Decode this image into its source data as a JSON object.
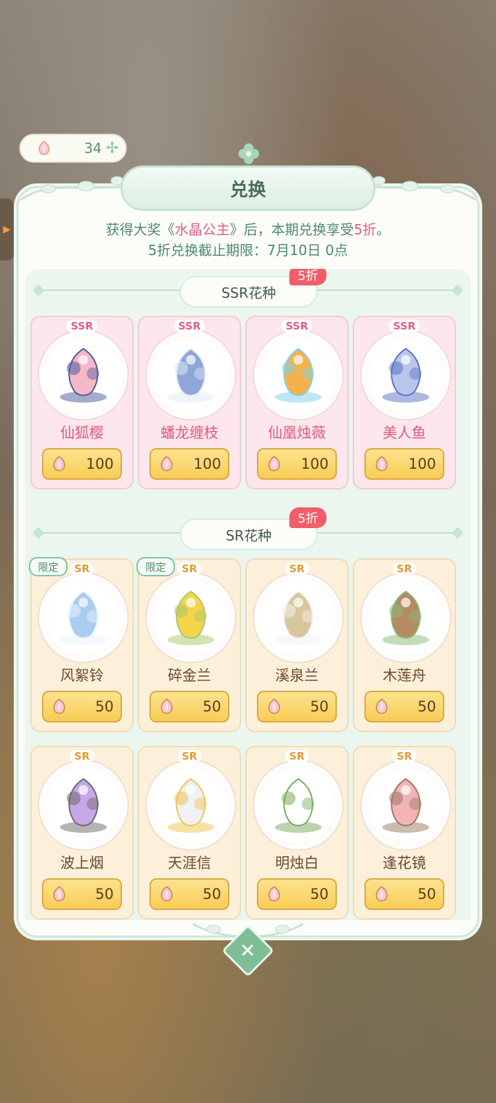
{
  "currency": {
    "amount": "34",
    "icon": "flower-seed-icon",
    "add_icon": "plus-icon"
  },
  "title": "兑换",
  "intro": {
    "line1_prefix": "获得大奖《",
    "line1_prize": "水晶公主",
    "line1_mid": "》后，本期兑换享受",
    "line1_discount": "5折",
    "line1_suffix": "。",
    "line2": "5折兑换截止期限：7月10日 0点"
  },
  "sections": [
    {
      "title": "SSR花种",
      "discount_tag": "5折",
      "items": [
        {
          "rarity": "SSR",
          "name": "仙狐樱",
          "price": "100",
          "art": "fox-shrine-icon",
          "limited": ""
        },
        {
          "rarity": "SSR",
          "name": "蟠龙缠枝",
          "price": "100",
          "art": "dragon-icon",
          "limited": ""
        },
        {
          "rarity": "SSR",
          "name": "仙凰烛薇",
          "price": "100",
          "art": "phoenix-icon",
          "limited": ""
        },
        {
          "rarity": "SSR",
          "name": "美人鱼",
          "price": "100",
          "art": "mermaid-icon",
          "limited": ""
        }
      ]
    },
    {
      "title": "SR花种",
      "discount_tag": "5折",
      "items": [
        {
          "rarity": "SR",
          "name": "风絮铃",
          "price": "50",
          "art": "bluebell-icon",
          "limited": "限定"
        },
        {
          "rarity": "SR",
          "name": "碎金兰",
          "price": "50",
          "art": "yellow-flower-icon",
          "limited": "限定"
        },
        {
          "rarity": "SR",
          "name": "溪泉兰",
          "price": "50",
          "art": "fountain-orchid-icon",
          "limited": ""
        },
        {
          "rarity": "SR",
          "name": "木莲舟",
          "price": "50",
          "art": "wooden-boat-icon",
          "limited": ""
        },
        {
          "rarity": "SR",
          "name": "波上烟",
          "price": "50",
          "art": "purple-lotus-icon",
          "limited": ""
        },
        {
          "rarity": "SR",
          "name": "天涯信",
          "price": "50",
          "art": "cloud-house-icon",
          "limited": ""
        },
        {
          "rarity": "SR",
          "name": "明烛白",
          "price": "50",
          "art": "white-lily-icon",
          "limited": ""
        },
        {
          "rarity": "SR",
          "name": "逢花镜",
          "price": "50",
          "art": "flower-mirror-icon",
          "limited": ""
        }
      ]
    }
  ],
  "colors": {
    "accent_green": "#4e8a6c",
    "highlight_pink": "#e25d84",
    "ssr_card": "#fde6ec",
    "sr_card": "#fdf0da",
    "price_button": "#f8cc55"
  }
}
